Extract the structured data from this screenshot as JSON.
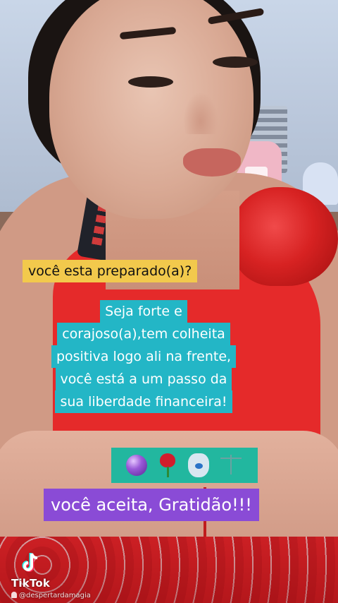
{
  "watermark": {
    "brand": "TikTok",
    "username": "@despertardamagia"
  },
  "captions": {
    "question": "você esta preparado(a)?",
    "main_lines": [
      "Seja forte e",
      "corajoso(a),tem colheita",
      "positiva logo ali na frente,",
      "você está a um passo da",
      "sua liberdade financeira!"
    ],
    "emojis": [
      "crystal-ball",
      "rose",
      "hamsa",
      "balance-scale"
    ],
    "closing": "você aceita, Gratidão!!!"
  },
  "colors": {
    "question_bg": "#f2c94c",
    "main_bg": "#23b6c6",
    "emoji_bg": "#22b79f",
    "closing_bg": "#8a4bd6",
    "dress": "#e52a2a"
  }
}
